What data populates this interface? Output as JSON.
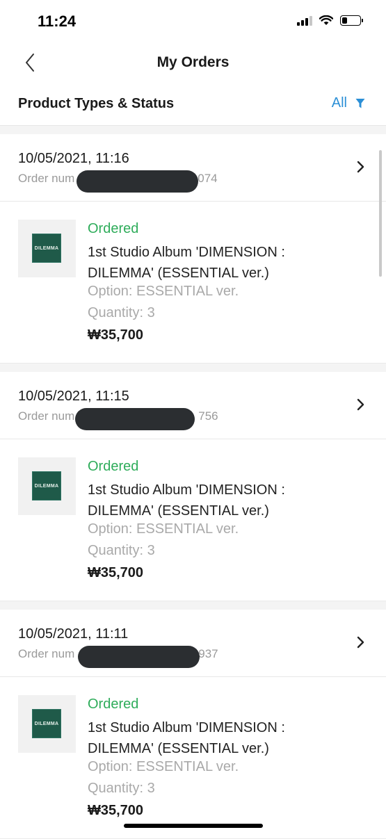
{
  "status_bar": {
    "time": "11:24",
    "battery_level": 0.3
  },
  "header": {
    "title": "My Orders"
  },
  "filter": {
    "title": "Product Types & Status",
    "label": "All"
  },
  "orders": [
    {
      "date": "10/05/2021, 11:16",
      "number_prefix": "Order num",
      "number_suffix": "074",
      "item": {
        "status": "Ordered",
        "name": "1st Studio Album 'DIMENSION : DILEMMA' (ESSENTIAL ver.)",
        "option": "Option: ESSENTIAL ver.",
        "quantity": "Quantity: 3",
        "price": "₩35,700",
        "thumb_text": "DILEMMA"
      }
    },
    {
      "date": "10/05/2021, 11:15",
      "number_prefix": "Order num",
      "number_suffix": "756",
      "item": {
        "status": "Ordered",
        "name": "1st Studio Album 'DIMENSION : DILEMMA' (ESSENTIAL ver.)",
        "option": "Option: ESSENTIAL ver.",
        "quantity": "Quantity: 3",
        "price": "₩35,700",
        "thumb_text": "DILEMMA"
      }
    },
    {
      "date": "10/05/2021, 11:11",
      "number_prefix": "Order num",
      "number_suffix": "937",
      "item": {
        "status": "Ordered",
        "name": "1st Studio Album 'DIMENSION : DILEMMA' (ESSENTIAL ver.)",
        "option": "Option: ESSENTIAL ver.",
        "quantity": "Quantity: 3",
        "price": "₩35,700",
        "thumb_text": "DILEMMA"
      }
    }
  ],
  "colors": {
    "accent": "#2b8fd6",
    "status_ordered": "#2eac5a",
    "muted": "#a9a9a9",
    "album_green": "#1f5a49"
  }
}
